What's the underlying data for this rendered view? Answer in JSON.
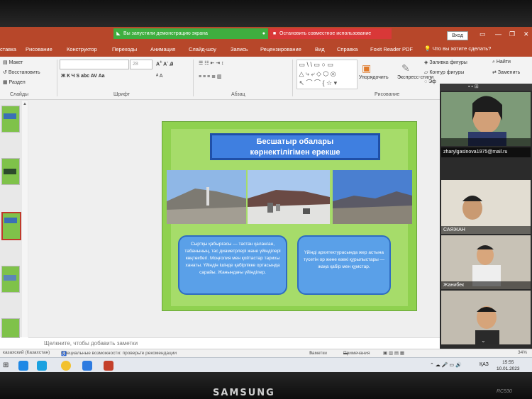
{
  "share_bar": {
    "demo_message": "Вы запустили демонстрацию экрана",
    "stop_label": "Остановить совместное использование"
  },
  "window": {
    "login_label": "Вход"
  },
  "ribbon_tabs": [
    "ставка",
    "Рисование",
    "Конструктор",
    "Переходы",
    "Анимация",
    "Слайд-шоу",
    "Запись",
    "Рецензирование",
    "Вид",
    "Справка",
    "Foxit Reader PDF"
  ],
  "tell_me": "Что вы хотите сделать?",
  "ribbon": {
    "layout": "Макет",
    "reset": "Восстановить",
    "section": "Раздел",
    "slides_group": "Слайды",
    "font_group": "Шрифт",
    "paragraph_group": "Абзац",
    "drawing_group": "Рисование",
    "font_size": "28",
    "arrange": "Упорядочить",
    "quick_styles": "Экспресс-стили",
    "shape_fill": "Заливка фигуры",
    "shape_outline": "Контур фигуры",
    "shape_effects": "Эф",
    "find": "Найти",
    "replace": "Заменить"
  },
  "slide": {
    "title_line1": "Бесшатыр обалары",
    "title_line2": "көрнектілігімен ерекше",
    "bubble_left": "Сыртқы қабырғасы — тастан қаланған, табанының, тас диаметрлері және үйінділері көңтөкбегі. Моңғолия мен қойтастар тарихы ханаты. Үйіндін ішінде қабірлікке ортасында сарайы. Жанындағы үйінділер.",
    "bubble_right": "Үйінді архитектурасында жер астына түсетін ор және өзекі құрылыстары — жаңа қабір мен құмстар."
  },
  "notes_placeholder": "Щелкните, чтобы добавить заметки",
  "participants": [
    {
      "name": ""
    },
    {
      "name": "zharylgasinova1975@mail.ru"
    },
    {
      "name": "САЯЖАН"
    },
    {
      "name": "Жанибек"
    },
    {
      "name": ""
    }
  ],
  "status": {
    "language": "казахский (Казахстан)",
    "accessibility": "Специальные возможности: проверьте рекомендации",
    "notes": "Заметки",
    "comments": "Примечания",
    "zoom": "34%"
  },
  "taskbar": {
    "lang": "ҚАЗ",
    "time": "15:55",
    "date": "10.01.2023"
  },
  "monitor": {
    "brand": "SAMSUNG",
    "model": "RC530"
  },
  "colors": {
    "accent": "#b7472a",
    "slide_bg": "#8fd14f",
    "title_blue": "#3f7fe0",
    "bubble_blue": "#5aa0e8",
    "share_green": "#3fae3f",
    "share_red": "#d93838"
  }
}
